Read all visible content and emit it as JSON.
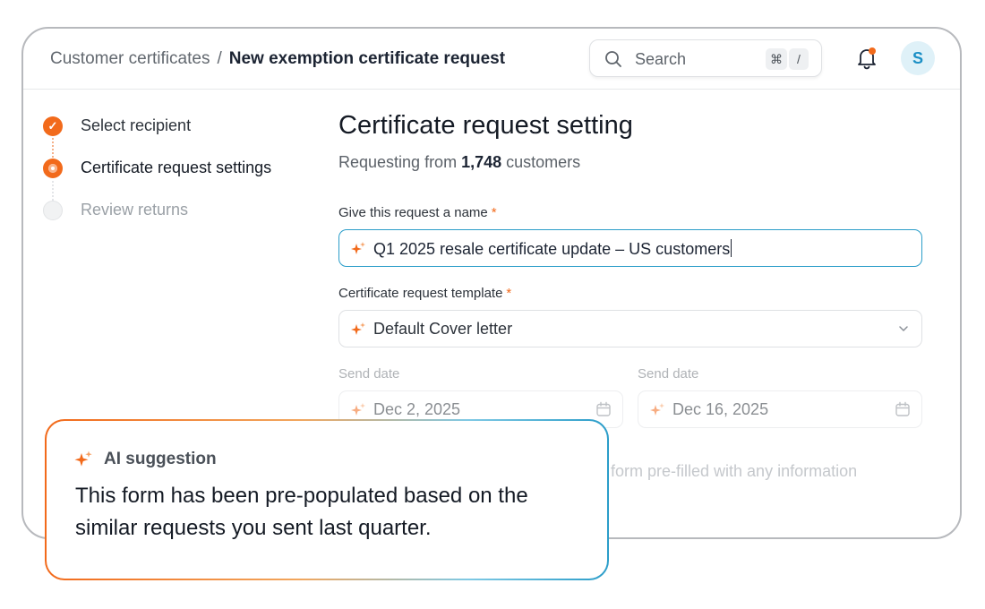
{
  "header": {
    "breadcrumb_parent": "Customer certificates",
    "breadcrumb_separator": "/",
    "breadcrumb_current": "New exemption certificate request",
    "search_placeholder": "Search",
    "shortcut_key_1": "⌘",
    "shortcut_key_2": "/",
    "avatar_initial": "S",
    "notification_dot_color": "#f26a1b"
  },
  "stepper": {
    "steps": [
      {
        "label": "Select recipient",
        "state": "done"
      },
      {
        "label": "Certificate request settings",
        "state": "current"
      },
      {
        "label": "Review returns",
        "state": "todo"
      }
    ]
  },
  "main": {
    "title": "Certificate request setting",
    "subtitle_prefix": "Requesting from",
    "customer_count": "1,748",
    "subtitle_suffix": "customers",
    "name_field": {
      "label": "Give this request a name",
      "required_mark": "*",
      "value": "Q1 2025 resale certificate update – US customers"
    },
    "template_field": {
      "label": "Certificate request template",
      "required_mark": "*",
      "value": "Default Cover letter"
    },
    "send_date_1": {
      "label": "Send date",
      "value": "Dec 2, 2025"
    },
    "send_date_2": {
      "label": "Send date",
      "value": "Dec 16, 2025"
    },
    "partial_text": "form pre-filled with any information"
  },
  "ai_suggestion": {
    "title": "AI suggestion",
    "body": "This form has been pre-populated based on the similar requests you sent last quarter."
  },
  "colors": {
    "accent_orange": "#f26a1b",
    "accent_blue": "#2b9dc9"
  },
  "icons": {
    "search": "search-icon",
    "bell": "bell-icon",
    "sparkle": "sparkle-icon",
    "chevron": "chevron-down-icon",
    "calendar": "calendar-icon"
  }
}
